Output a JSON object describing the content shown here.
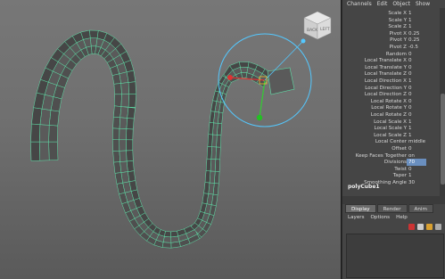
{
  "menu": [
    "Channels",
    "Edit",
    "Object",
    "Show"
  ],
  "viewcube": {
    "front": "BACK",
    "side": "LEFT"
  },
  "channels": [
    {
      "label": "Scale X",
      "value": "1"
    },
    {
      "label": "Scale Y",
      "value": "1"
    },
    {
      "label": "Scale Z",
      "value": "1"
    },
    {
      "label": "Pivot X",
      "value": "0.25"
    },
    {
      "label": "Pivot Y",
      "value": "0.25"
    },
    {
      "label": "Pivot Z",
      "value": "-0.5"
    },
    {
      "label": "Random",
      "value": "0"
    },
    {
      "label": "Local Translate X",
      "value": "0"
    },
    {
      "label": "Local Translate Y",
      "value": "0"
    },
    {
      "label": "Local Translate Z",
      "value": "0"
    },
    {
      "label": "Local Direction X",
      "value": "1"
    },
    {
      "label": "Local Direction Y",
      "value": "0"
    },
    {
      "label": "Local Direction Z",
      "value": "0"
    },
    {
      "label": "Local Rotate X",
      "value": "0"
    },
    {
      "label": "Local Rotate Y",
      "value": "0"
    },
    {
      "label": "Local Rotate Z",
      "value": "0"
    },
    {
      "label": "Local Scale X",
      "value": "1"
    },
    {
      "label": "Local Scale Y",
      "value": "1"
    },
    {
      "label": "Local Scale Z",
      "value": "1"
    },
    {
      "label": "Local Center",
      "value": "middle"
    },
    {
      "label": "Offset",
      "value": "0"
    },
    {
      "label": "Keep Faces Together",
      "value": "on"
    },
    {
      "label": "Divisions",
      "value": "70",
      "highlight": true
    },
    {
      "label": "Twist",
      "value": "0"
    },
    {
      "label": "Taper",
      "value": "1"
    },
    {
      "label": "Smoothing Angle",
      "value": "30"
    }
  ],
  "object_name": "polyCube1",
  "tabs": [
    "Display",
    "Render",
    "Anim"
  ],
  "layer_menu": [
    "Layers",
    "Options",
    "Help"
  ],
  "colors": {
    "wire": "#5fe0a8",
    "manip": "#54c8ff",
    "mesh": "#555555",
    "highlight": "#6a8fbf"
  }
}
